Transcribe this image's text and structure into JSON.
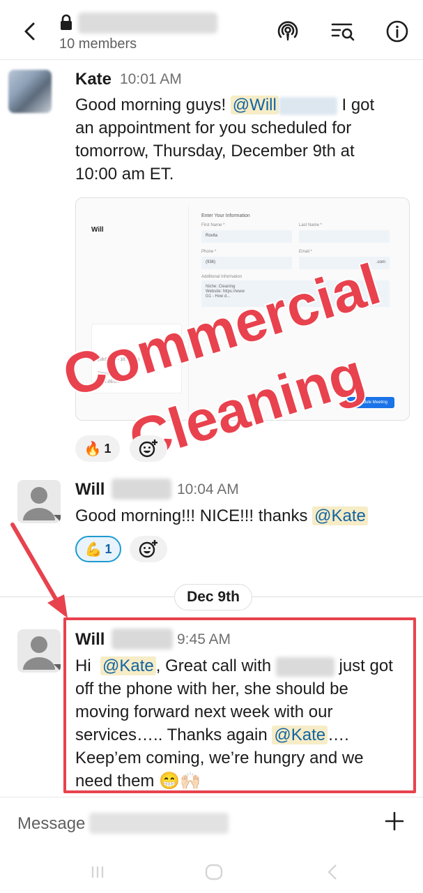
{
  "header": {
    "members": "10 members"
  },
  "messages": [
    {
      "sender": "Kate",
      "time": "10:01 AM",
      "mention": "@Will",
      "text_a": "Good morning guys!",
      "text_b": "I got",
      "text_c": "an appointment for you scheduled for",
      "text_d": "tomorrow, Thursday, December 9th at",
      "text_e": "10:00 am ET.",
      "attachment": {
        "name": "Will",
        "form_title": "Enter Your Information",
        "first_name_label": "First Name *",
        "first_name_value": "Rovita",
        "last_name_label": "Last Name *",
        "phone_label": "Phone *",
        "phone_value": "(936)",
        "email_label": "Email *",
        "email_value": ".com",
        "additional_label": "Additional Information",
        "additional_text": "Niche: Cleaning\nWebsite: https://www\nG1 - How d...",
        "timezone_label": "Timezone",
        "time_slot": "(09:00 AM - 10:00 AM)",
        "tz_value": "GMT-05:0...",
        "button_label": "Schedule Meeting"
      },
      "watermark_line1": "Commercial",
      "watermark_line2": "Cleaning",
      "reaction": {
        "emoji": "🔥",
        "count": "1"
      }
    },
    {
      "sender": "Will",
      "time": "10:04 AM",
      "text": "Good morning!!! NICE!!! thanks",
      "mention": "@Kate",
      "reaction": {
        "emoji": "💪",
        "count": "1"
      }
    },
    {
      "sender": "Will",
      "time": "9:45 AM",
      "hi": "Hi",
      "mention1": "@Kate",
      "text_a": ", Great call with",
      "text_b": "just got",
      "text_c": "off the phone with her, she should be",
      "text_d": "moving forward next week with our",
      "text_e": "services….. Thanks again",
      "mention2": "@Kate",
      "text_f": "….",
      "text_g": "Keep’em coming, we’re hungry and we",
      "text_h": "need them 😁🙌🏻"
    }
  ],
  "date_divider": "Dec 9th",
  "composer": {
    "placeholder": "Message"
  },
  "colors": {
    "mention_text": "#1264a3",
    "mention_bg": "#f6ecc6",
    "highlight": "#e8424e",
    "active_reaction_border": "#1d9bd1"
  },
  "icons": [
    "back-arrow-icon",
    "lock-icon",
    "huddle-icon",
    "search-in-channel-icon",
    "info-icon",
    "add-reaction-icon",
    "plus-icon"
  ]
}
